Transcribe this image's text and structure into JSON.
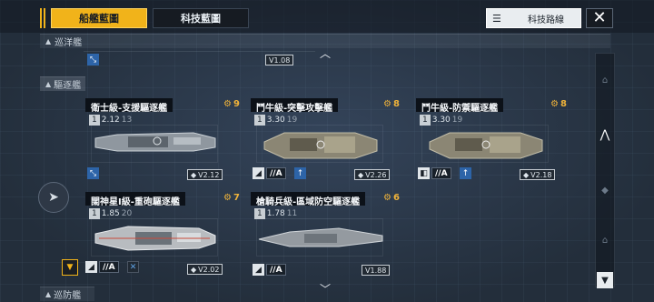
{
  "tabs": [
    {
      "label": "船艦藍圖",
      "active": true
    },
    {
      "label": "科技藍圖",
      "active": false
    }
  ],
  "roadmap": {
    "label": "科技路線",
    "icon": "list-icon"
  },
  "sections": {
    "cruiser": "巡洋艦",
    "destroyer": "驅逐艦",
    "frigate": "巡防艦"
  },
  "cruiser_partial": {
    "version": "V1.08"
  },
  "cards": [
    {
      "title": "衛士級-支援驅逐艦",
      "count": "9",
      "tier": "1",
      "level": "2.12",
      "level_sub": "13",
      "version": "V2.12",
      "rank": "",
      "icons": [
        "blue-icon"
      ]
    },
    {
      "title": "鬥牛級-突擊攻擊艦",
      "count": "8",
      "tier": "1",
      "level": "3.30",
      "level_sub": "19",
      "version": "V2.26",
      "rank": "//A",
      "icons": [
        "white-icon",
        "blue-icon"
      ]
    },
    {
      "title": "鬥牛級-防禦驅逐艦",
      "count": "8",
      "tier": "1",
      "level": "3.30",
      "level_sub": "19",
      "version": "V2.18",
      "rank": "//A",
      "icons": [
        "white-icon",
        "blue-icon"
      ]
    },
    {
      "title": "闊神星I級-重砲驅逐艦",
      "count": "7",
      "tier": "1",
      "level": "1.85",
      "level_sub": "20",
      "version": "V2.02",
      "rank": "//A",
      "icons": [
        "white-icon",
        "blue-icon"
      ]
    },
    {
      "title": "槍騎兵級-區域防空驅逐艦",
      "count": "6",
      "tier": "1",
      "level": "1.78",
      "level_sub": "11",
      "version": "V1.88",
      "rank": "//A",
      "icons": [
        "white-icon"
      ]
    }
  ],
  "colors": {
    "accent": "#f1b31a",
    "bg": "#2a3543",
    "title_bg": "#0c1118"
  }
}
